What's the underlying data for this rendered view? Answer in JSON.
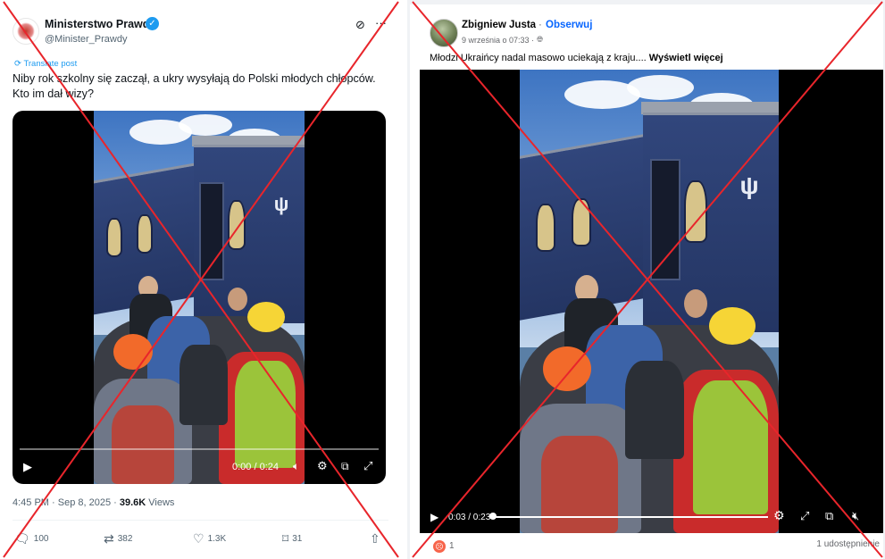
{
  "tweet": {
    "author_name": "Ministerstwo Prawdy",
    "author_handle": "@Minister_Prawdy",
    "translate_label": "Translate post",
    "text": "Niby rok szkolny się zaczął, a ukry wysyłają do Polski młodych chłopców. Kto im dał wizy?",
    "video": {
      "time": "0:00 / 0:24"
    },
    "meta": {
      "time_date": "4:45 PM · Sep 8, 2025 · ",
      "views_count": "39.6K",
      "views_label": " Views"
    },
    "actions": {
      "replies": "100",
      "reposts": "382",
      "likes": "1.3K",
      "bookmarks": "31"
    }
  },
  "fb_post": {
    "author_name": "Zbigniew Justa",
    "separator": "·",
    "follow_label": "Obserwuj",
    "date": "9 września o 07:33 ·",
    "text": "Młodzi Ukraińcy nadal masowo uciekają z kraju.... ",
    "see_more": "Wyświetl więcej",
    "video": {
      "time": "0:03 / 0:23"
    },
    "reaction_count": "1",
    "shares": "1 udostępnienie"
  },
  "overlay": {
    "cross_color": "#e8252b"
  },
  "colors": {
    "twitter_blue": "#1d9bf0",
    "facebook_blue": "#0866ff"
  }
}
